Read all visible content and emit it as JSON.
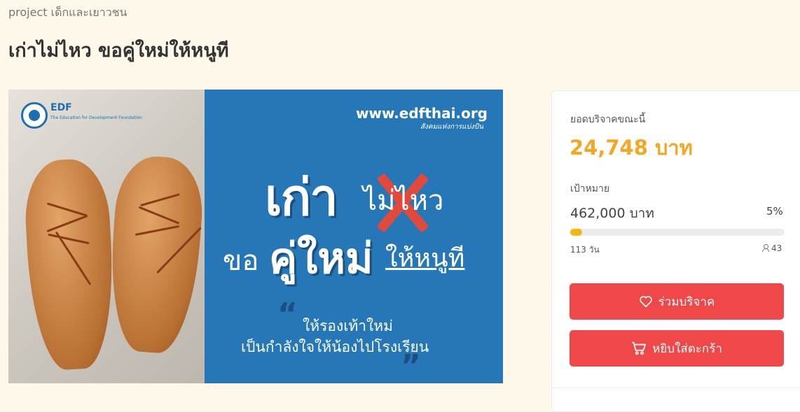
{
  "header": {
    "category": "project เด็กและเยาวชน",
    "title": "เก่าไม่ไหว ขอคู่ใหม่ให้หนูที"
  },
  "banner": {
    "logo_text": "EDF",
    "logo_sub": "The Education for Development Foundation",
    "url": "www.edfthai.org",
    "url_sub": "สังคมแห่งการแบ่งปัน",
    "line1_bold": "เก่า",
    "line1_rest": "ไม่ไหว",
    "line2_a": "ขอ",
    "line2_b": "คู่ใหม่",
    "line2_c": "ให้หนูที",
    "sub_line1": "ให้รองเท้าใหม่",
    "sub_line2": "เป็นกำลังใจให้น้องไปโรงเรียน",
    "quote_open": "“",
    "quote_close": "”"
  },
  "donation": {
    "raised_label": "ยอดบริจาคขณะนี้",
    "raised_amount": "24,748 บาท",
    "goal_label": "เป้าหมาย",
    "goal_amount": "462,000 บาท",
    "percent": "5%",
    "progress_fraction": 0.054,
    "days_left": "113 วัน",
    "backers": "43",
    "donate_button": "ร่วมบริจาค",
    "cart_button": "หยิบใส่ตะกร้า"
  },
  "colors": {
    "accent": "#f5a623",
    "button": "#f04848",
    "banner_blue": "#2577b8",
    "background": "#fdf8ea"
  }
}
